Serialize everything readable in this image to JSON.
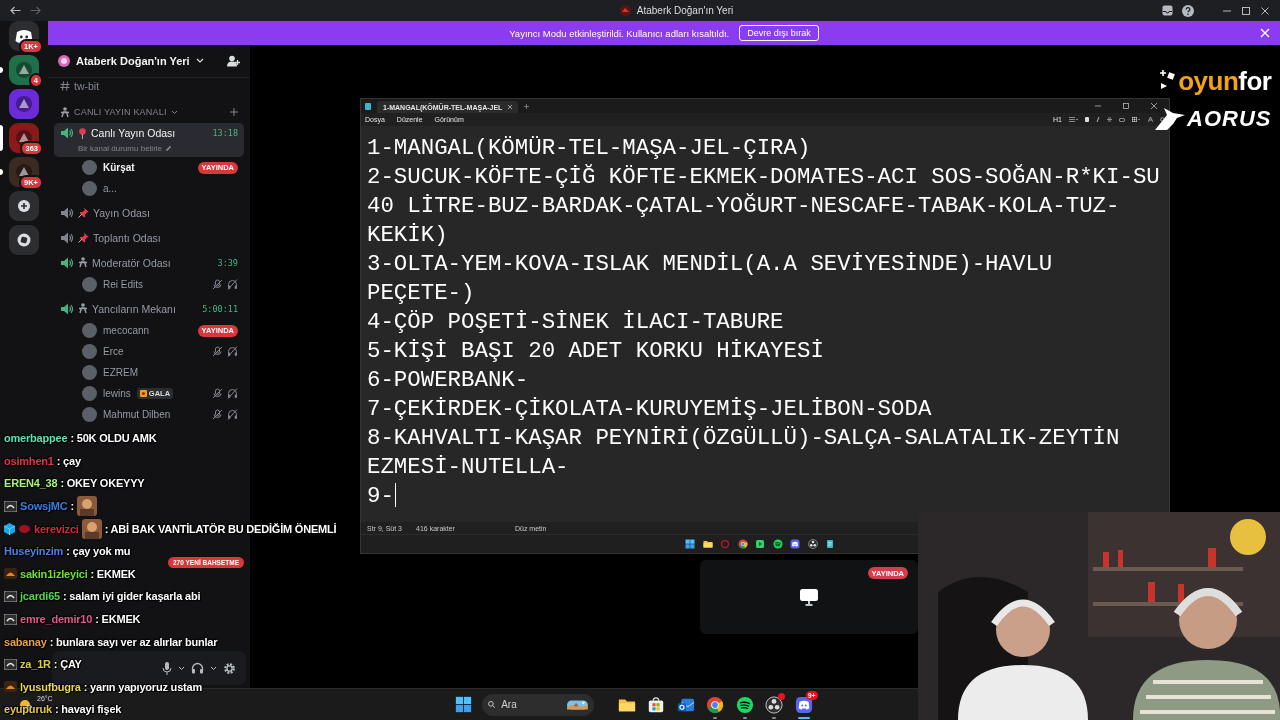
{
  "title_bar": {
    "title": "Ataberk Doğan'ın Yeri"
  },
  "banner": {
    "message": "Yayıncı Modu etkinleştirildi. Kullanıcı adları kısaltıldı.",
    "button": "Devre dışı bırak"
  },
  "servers": [
    {
      "kind": "home",
      "badge": "1K+",
      "color": "#2b2d31",
      "selected": false,
      "unread": false
    },
    {
      "kind": "server",
      "badge": "4",
      "color": "#1f6f4a",
      "selected": false,
      "unread": true
    },
    {
      "kind": "server",
      "color": "#6a2bd9",
      "selected": false,
      "unread": false
    },
    {
      "kind": "server",
      "badge": "363",
      "color": "#8a1a1a",
      "selected": true,
      "unread": false
    },
    {
      "kind": "server",
      "badge": "9K+",
      "color": "#3a2a20",
      "selected": false,
      "unread": true
    },
    {
      "kind": "add",
      "color": "#2b2d31",
      "selected": false,
      "unread": false
    },
    {
      "kind": "discover",
      "color": "#2b2d31",
      "selected": false,
      "unread": false
    }
  ],
  "sidebar": {
    "server_name": "Ataberk Doğan'ın Yeri",
    "channels": [
      {
        "kind": "text",
        "name": "tw-bit"
      },
      {
        "kind": "category",
        "name": "CANLI YAYIN KANALI"
      },
      {
        "kind": "voice",
        "prefix": {
          "kind": "pin"
        },
        "name": "Canlı Yayın Odası",
        "active": true,
        "selected": true,
        "timer": "13:18",
        "status": "Bir kanal durumu belirle"
      },
      {
        "kind": "user",
        "name": "Kürşat",
        "self": true,
        "badge": "YAYINDA",
        "muted": false
      },
      {
        "kind": "user",
        "name": "a...",
        "self": false,
        "muted": false
      },
      {
        "kind": "voice",
        "prefix": {
          "kind": "pushpin"
        },
        "name": "Yayın Odası",
        "active": false,
        "selected": false
      },
      {
        "kind": "voice",
        "prefix": {
          "kind": "pushpin"
        },
        "name": "Toplantı Odası",
        "active": false,
        "selected": false
      },
      {
        "kind": "voice",
        "prefix": {
          "kind": "figure"
        },
        "name": "Moderatör Odası",
        "active": true,
        "selected": false,
        "timer": "3:39"
      },
      {
        "kind": "user",
        "name": "Rei Edits",
        "self": false,
        "muted": true
      },
      {
        "kind": "voice",
        "prefix": {
          "kind": "figure"
        },
        "name": "Yancıların Mekanı",
        "active": true,
        "selected": false,
        "timer": "5:00:11"
      },
      {
        "kind": "user",
        "name": "mecocann",
        "self": false,
        "badge": "YAYINDA",
        "muted": false
      },
      {
        "kind": "user",
        "name": "Erce",
        "self": false,
        "muted": true
      },
      {
        "kind": "user",
        "name": "EZREM",
        "self": false,
        "muted": false
      },
      {
        "kind": "user",
        "name": "lewins",
        "self": false,
        "tag": "GALA",
        "muted": true
      },
      {
        "kind": "user",
        "name": "Mahmut Dilben",
        "self": false,
        "muted": true
      }
    ],
    "mentions": "270 YENİ BAHSETME"
  },
  "notepad": {
    "tab": "1-MANGAL(KÖMÜR-TEL-MAŞA-JEL",
    "menus": [
      "Dosya",
      "Düzenle",
      "Görünüm"
    ],
    "heading": "H1",
    "lines": [
      "1-MANGAL(KÖMÜR-TEL-MAŞA-JEL-ÇIRA)",
      "2-SUCUK-KÖFTE-ÇİĞ KÖFTE-EKMEK-DOMATES-ACI SOS-SOĞAN-R*KI-SU 40 LİTRE-BUZ-BARDAK-ÇATAL-YOĞURT-NESCAFE-TABAK-KOLA-TUZ-KEKİK)",
      "3-OLTA-YEM-KOVA-ISLAK MENDİL(A.A SEVİYESİNDE)-HAVLU PEÇETE-)",
      "4-ÇÖP POŞETİ-SİNEK İLACI-TABURE",
      "5-KİŞİ BAŞI 20 ADET KORKU HİKAYESİ",
      "6-POWERBANK-",
      "7-ÇEKİRDEK-ÇİKOLATA-KURUYEMİŞ-JELİBON-SODA",
      "8-KAHVALTI-KAŞAR PEYNİRİ(ÖZGÜLLÜ)-SALÇA-SALATALIK-ZEYTİN EZMESİ-NUTELLA-",
      "9-"
    ],
    "cursor": true,
    "status": [
      "Str 9, Süt 3",
      "416 karakter",
      "Düz metin"
    ],
    "inner_taskbar": [
      {
        "kind": "start"
      },
      {
        "kind": "folder"
      },
      {
        "kind": "ring"
      },
      {
        "kind": "browser"
      },
      {
        "kind": "media"
      },
      {
        "kind": "music"
      },
      {
        "kind": "chat"
      },
      {
        "kind": "record"
      },
      {
        "kind": "notepad"
      }
    ]
  },
  "stream_tile": {
    "badge": "YAYINDA"
  },
  "logos": {
    "brand_part_1": "oyun",
    "brand_part_2": "for",
    "sponsor": "AORUS"
  },
  "chat": [
    {
      "user": "omerbappee",
      "color": "#63e0b4",
      "message": ": 50K OLDU AMK"
    },
    {
      "user": "osimhen1",
      "color": "#e8304a",
      "message": ": çay"
    },
    {
      "user": "EREN4_38",
      "color": "#a8f07a",
      "message": ": OKEY OKEYYY"
    },
    {
      "user": "SowsjMC",
      "color": "#3c7de0",
      "message": ":",
      "badges": [
        {
          "kind": "gray"
        }
      ],
      "emote": {
        "kind": "after"
      }
    },
    {
      "user": "kerevizci",
      "color": "#d8283c",
      "message": ": ABİ BAK VANTİLATÖR BU DEDİĞİM ÖNEMLİ",
      "badges": [
        {
          "kind": "cube"
        },
        {
          "kind": "red"
        }
      ],
      "emote": {
        "kind": "before"
      }
    },
    {
      "user": "Huseyinzim",
      "color": "#4a82e8",
      "message": ": çay yok mu"
    },
    {
      "user": "sakin1izleyici",
      "color": "#6de03a",
      "message": ": EKMEK",
      "badges": [
        {
          "kind": "orange"
        }
      ]
    },
    {
      "user": "jcardi65",
      "color": "#4fd84a",
      "message": ": salam iyi gider kaşarla abi",
      "badges": [
        {
          "kind": "gray"
        }
      ]
    },
    {
      "user": "emre_demir10",
      "color": "#e05a8a",
      "message": ": EKMEK",
      "badges": [
        {
          "kind": "gray"
        }
      ]
    },
    {
      "user": "sabanay",
      "color": "#e8a040",
      "message": ": bunlara sayı ver az alırlar bunlar"
    },
    {
      "user": "za_1R",
      "color": "#d8d040",
      "message": ": ÇAY",
      "badges": [
        {
          "kind": "gray"
        }
      ]
    },
    {
      "user": "lyusufbugra",
      "color": "#e8d850",
      "message": ": yarın yapıyoruz ustam",
      "badges": [
        {
          "kind": "orange"
        }
      ]
    },
    {
      "user": "eyupuruk",
      "color": "#e0c850",
      "message": ": havayi fişek"
    }
  ],
  "taskbar": {
    "weather": "26°C",
    "search_placeholder": "Ara",
    "apps": [
      {
        "kind": "folder",
        "running": false,
        "selected": false
      },
      {
        "kind": "store",
        "running": false,
        "selected": false
      },
      {
        "kind": "mail",
        "running": false,
        "selected": false
      },
      {
        "kind": "browser",
        "running": true,
        "selected": false
      },
      {
        "kind": "music",
        "running": true,
        "selected": false
      },
      {
        "kind": "record",
        "running": true,
        "selected": false,
        "alert": true
      },
      {
        "kind": "chat",
        "running": true,
        "selected": true,
        "badge": "9+"
      }
    ]
  }
}
